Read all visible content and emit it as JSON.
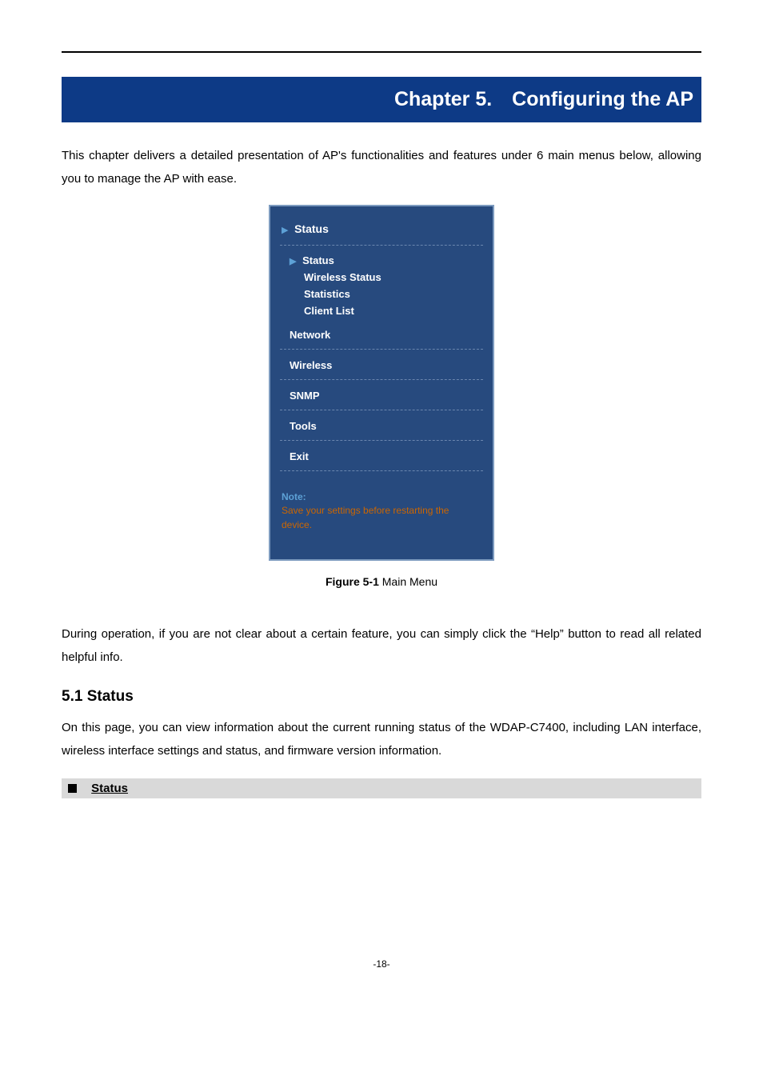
{
  "chapter_banner": {
    "left": "Chapter 5.",
    "right": "Configuring the AP"
  },
  "intro_para": "This chapter delivers a detailed presentation of AP's functionalities and features under 6 main menus below, allowing you to manage the AP with ease.",
  "menu": {
    "top": "Status",
    "sub": {
      "selected": "Status",
      "items": [
        "Wireless Status",
        "Statistics",
        "Client List"
      ]
    },
    "mains": [
      "Network",
      "Wireless",
      "SNMP",
      "Tools",
      "Exit"
    ],
    "note": {
      "title": "Note:",
      "body": "Save your settings before restarting the device."
    }
  },
  "figure_caption": {
    "bold": "Figure 5-1",
    "rest": " Main Menu"
  },
  "para2": "During operation, if you are not clear about a certain feature, you can simply click the “Help” button to read all related helpful info.",
  "section_heading": "5.1  Status",
  "section_para": "On this page, you can view information about the current running status of the WDAP-C7400, including LAN interface, wireless interface settings and status, and firmware version information.",
  "sub_banner": "Status",
  "page_number": "-18-"
}
